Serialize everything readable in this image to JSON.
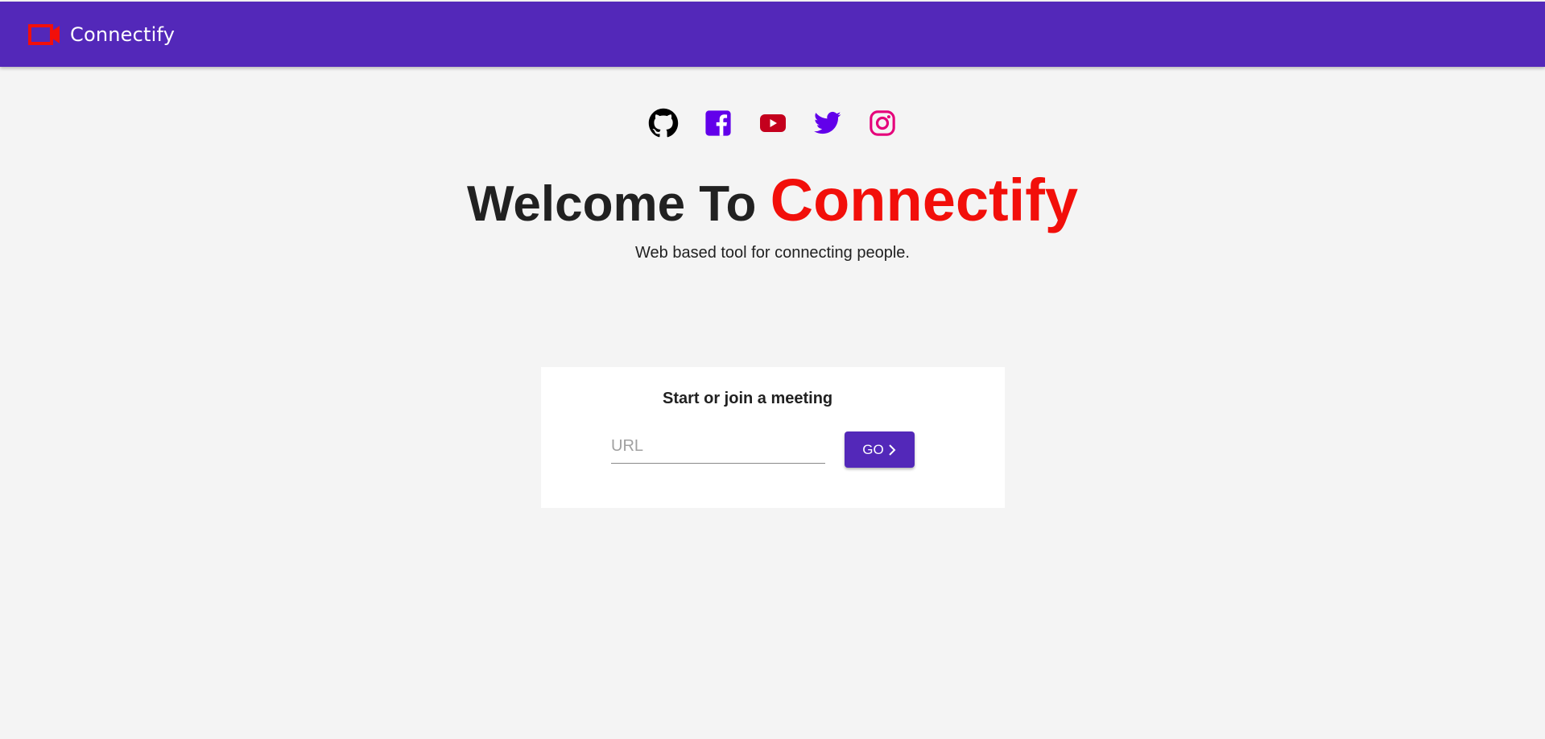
{
  "header": {
    "brand_name": "Connectify",
    "logo_icon": "video-camera-icon",
    "background_color": "#5328b9",
    "logo_color": "#f20f0a"
  },
  "socials": [
    {
      "name": "github",
      "icon": "github-icon",
      "color": "#000000"
    },
    {
      "name": "facebook",
      "icon": "facebook-icon",
      "color": "#6200ea"
    },
    {
      "name": "youtube",
      "icon": "youtube-icon",
      "color": "#c4001d"
    },
    {
      "name": "twitter",
      "icon": "twitter-icon",
      "color": "#6200ea"
    },
    {
      "name": "instagram",
      "icon": "instagram-icon",
      "color": "#e5007a"
    }
  ],
  "hero": {
    "welcome_prefix": "Welcome To",
    "welcome_brand": "Connectify",
    "tagline": "Web based tool for connecting people.",
    "brand_color": "#f20f0a"
  },
  "meeting_card": {
    "title": "Start or join a meeting",
    "url_placeholder": "URL",
    "url_value": "",
    "go_label": "GO",
    "go_icon": "chevron-right-icon"
  }
}
